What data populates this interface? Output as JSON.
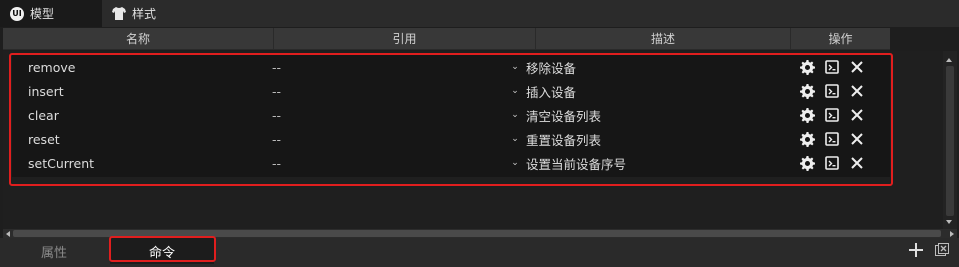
{
  "top_tabs": [
    {
      "label": "模型",
      "icon": "logo-icon",
      "logo_text": "UI"
    },
    {
      "label": "样式",
      "icon": "shirt-icon"
    }
  ],
  "columns": [
    "名称",
    "引用",
    "描述",
    "操作"
  ],
  "rows": [
    {
      "name": "remove",
      "ref": "--",
      "desc": "移除设备"
    },
    {
      "name": "insert",
      "ref": "--",
      "desc": "插入设备"
    },
    {
      "name": "clear",
      "ref": "--",
      "desc": "清空设备列表"
    },
    {
      "name": "reset",
      "ref": "--",
      "desc": "重置设备列表"
    },
    {
      "name": "setCurrent",
      "ref": "--",
      "desc": "设置当前设备序号"
    }
  ],
  "row_actions": [
    "gear-icon",
    "code-icon",
    "close-icon"
  ],
  "bottom_tabs": {
    "properties": "属性",
    "commands": "命令"
  },
  "colors": {
    "highlight": "#e01e1e",
    "background": "#1e1e1e"
  }
}
